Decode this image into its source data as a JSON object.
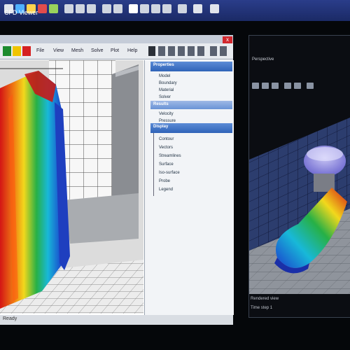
{
  "app": {
    "title": "CFD Viewer",
    "close_glyph": "x"
  },
  "toolbar": {
    "items": [
      "File",
      "View",
      "Mesh",
      "Solve",
      "Plot",
      "Help"
    ]
  },
  "panel": {
    "section1": {
      "title": "Properties",
      "items": [
        "Model",
        "Boundary",
        "Material",
        "Solver"
      ]
    },
    "section2": {
      "title": "Results",
      "items": [
        "Velocity",
        "Pressure"
      ]
    },
    "section3": {
      "title": "Display",
      "items": [
        "Contour",
        "Vectors",
        "Streamlines",
        "Surface",
        "Iso-surface",
        "Probe",
        "Legend"
      ]
    }
  },
  "status": {
    "text": "Ready"
  },
  "right_window": {
    "label": "Perspective",
    "footer1": "Rendered view",
    "footer2": "Time step 1"
  },
  "colors": {
    "accent": "#2f63b8",
    "title_bar": "#1b2a66",
    "close": "#d2272d",
    "cmap_red": "#d31515",
    "cmap_yellow": "#f2d81c",
    "cmap_green": "#27b046",
    "cmap_cyan": "#18b8d8",
    "cmap_blue": "#1a3ccd"
  }
}
